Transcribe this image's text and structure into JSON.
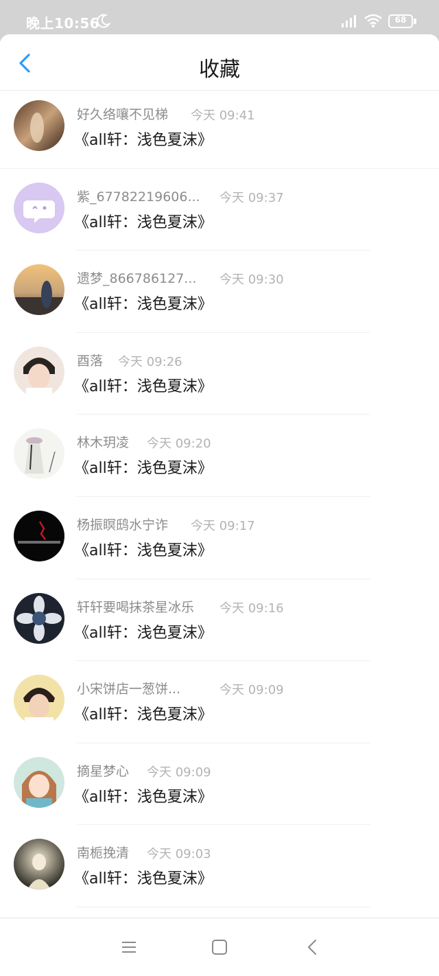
{
  "status_bar": {
    "time": "晚上10:56",
    "battery": "68",
    "icons": [
      "moon-icon",
      "signal-icon",
      "wifi-icon",
      "battery-icon"
    ]
  },
  "header": {
    "title": "收藏",
    "back_icon": "chevron-left-icon"
  },
  "colors": {
    "accent": "#2f9bf5",
    "status_bar_bg": "#d3d3d3",
    "name_text": "#8c8c8c",
    "time_text": "#b3b3b3",
    "title_text": "#1a1a1a"
  },
  "favorites": [
    {
      "name": "好久络嚷不见梯",
      "time": "今天 09:41",
      "title": "《all轩：浅色夏沫》"
    },
    {
      "name": "紫_67782219606...",
      "time": "今天 09:37",
      "title": "《all轩：浅色夏沫》"
    },
    {
      "name": "遗梦_866786127...",
      "time": "今天 09:30",
      "title": "《all轩：浅色夏沫》"
    },
    {
      "name": "酉落",
      "time": "今天 09:26",
      "title": "《all轩：浅色夏沫》"
    },
    {
      "name": "林木玥凌",
      "time": "今天 09:20",
      "title": "《all轩：浅色夏沫》"
    },
    {
      "name": "杨振瞑鸱水宁诈",
      "time": "今天 09:17",
      "title": "《all轩：浅色夏沫》"
    },
    {
      "name": "轩轩要喝抹茶星冰乐",
      "time": "今天 09:16",
      "title": "《all轩：浅色夏沫》"
    },
    {
      "name": "小宋饼店一葱饼...",
      "time": "今天 09:09",
      "title": "《all轩：浅色夏沫》"
    },
    {
      "name": "摘星梦心",
      "time": "今天 09:09",
      "title": "《all轩：浅色夏沫》"
    },
    {
      "name": "南栀挽清",
      "time": "今天 09:03",
      "title": "《all轩：浅色夏沫》"
    }
  ],
  "nav_bar": {
    "icons": [
      "menu-icon",
      "home-square-icon",
      "back-chevron-icon"
    ]
  }
}
